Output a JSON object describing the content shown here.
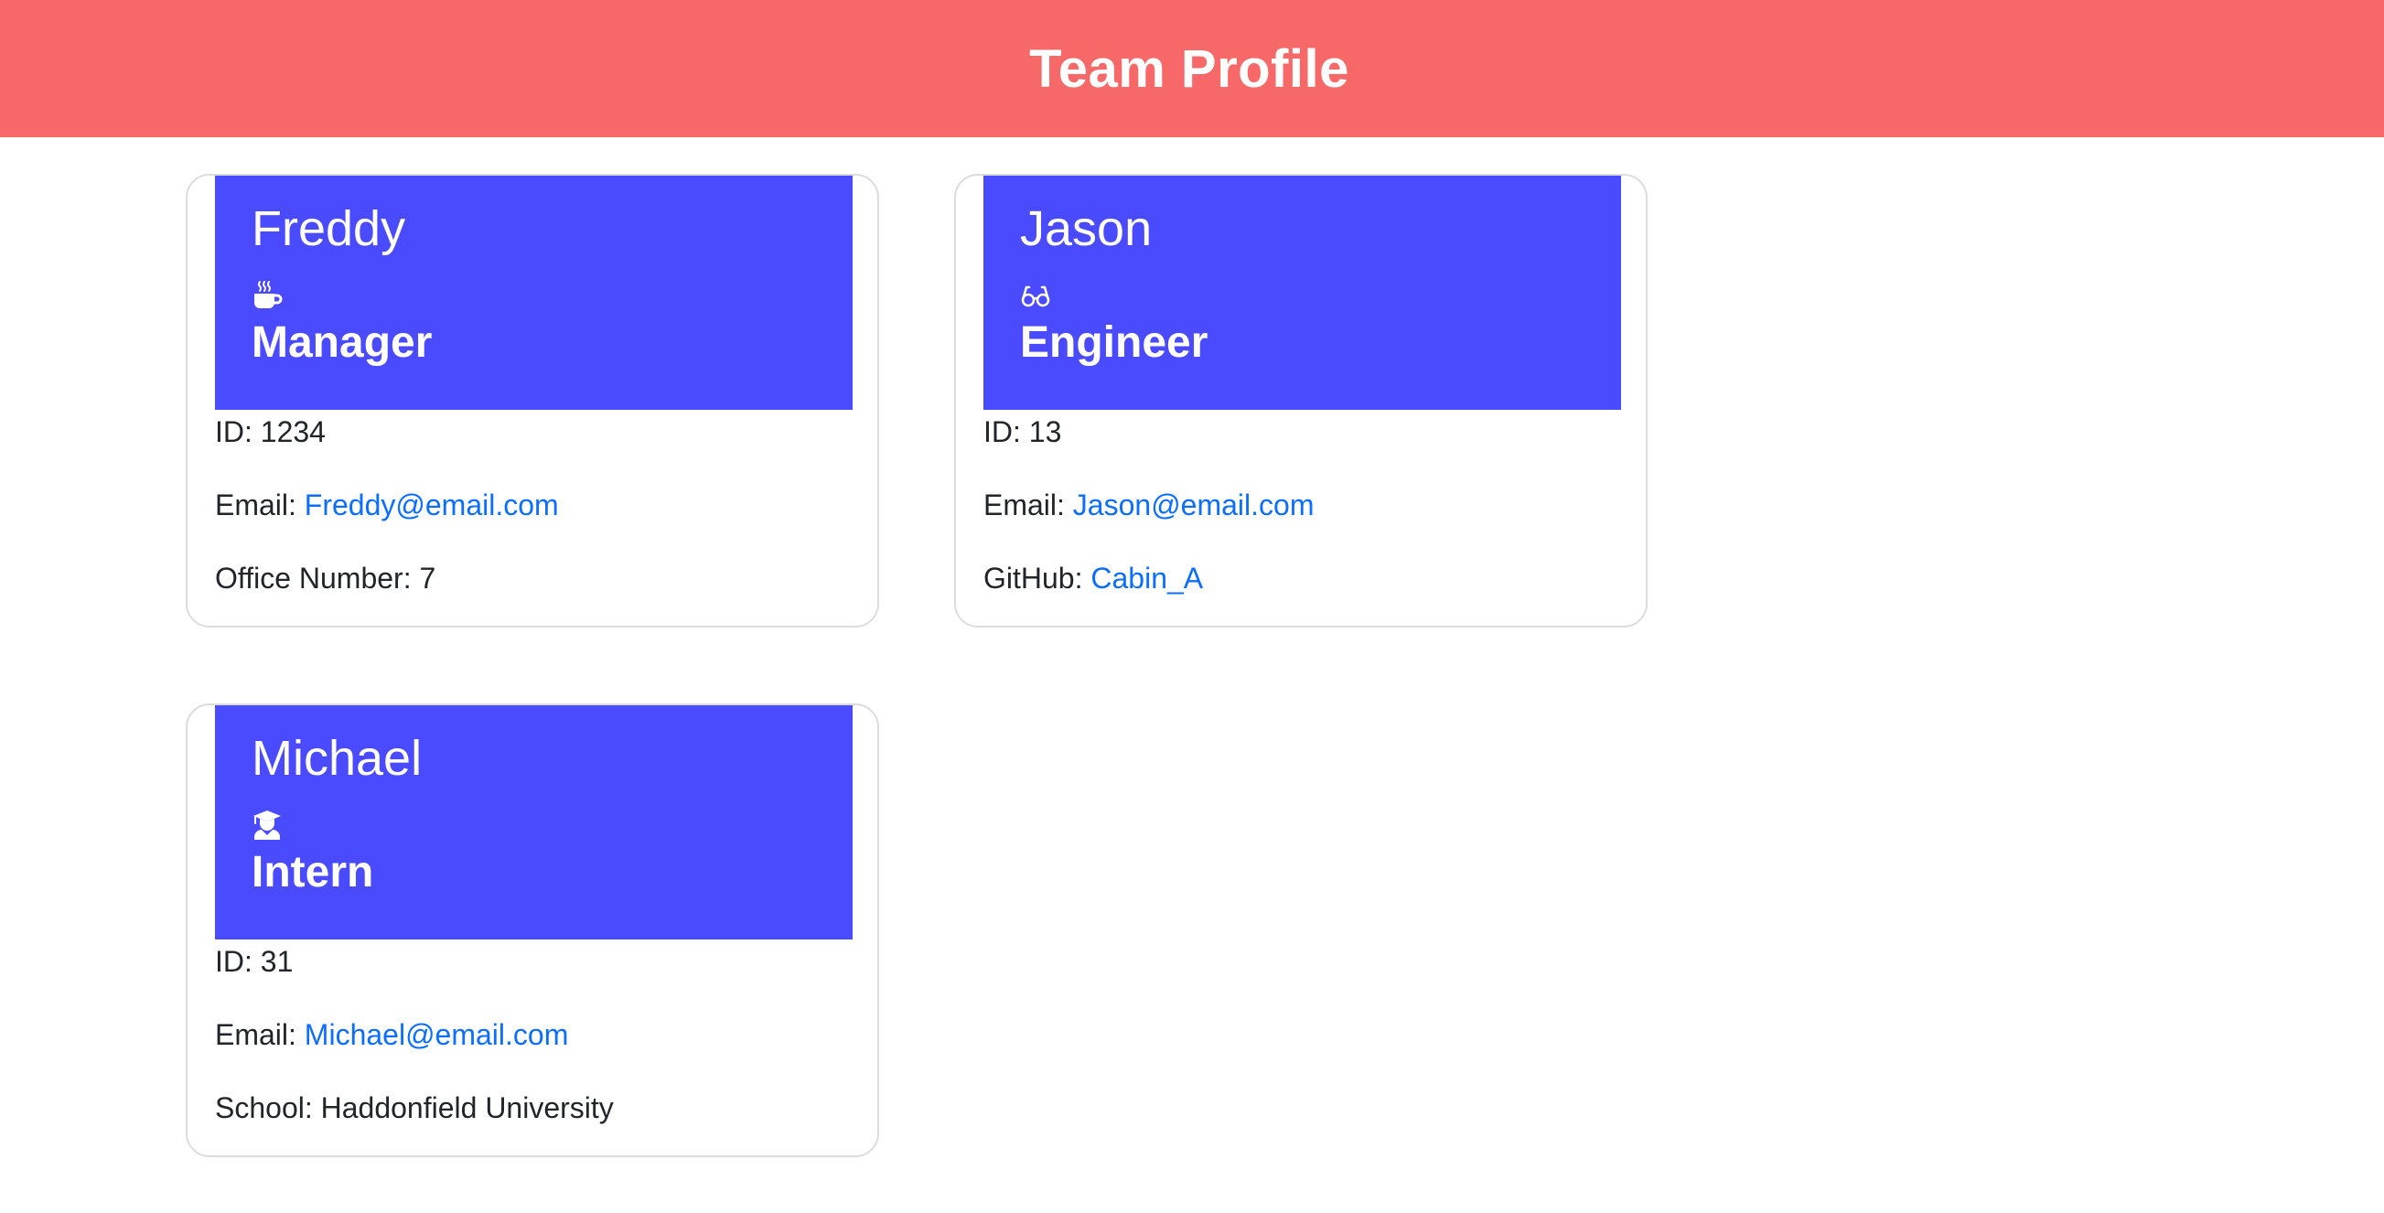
{
  "header": {
    "title": "Team Profile",
    "background_color": "#f76868"
  },
  "colors": {
    "card_header": "#4a4aff",
    "link": "#0d6efd"
  },
  "employees": [
    {
      "name": "Freddy",
      "icon": "mug-hot-icon",
      "role": "Manager",
      "id_label": "ID: ",
      "id": "1234",
      "email_label": "Email: ",
      "email": "Freddy@email.com",
      "extra_label": "Office Number: ",
      "extra_value": "7"
    },
    {
      "name": "Jason",
      "icon": "glasses-icon",
      "role": "Engineer",
      "id_label": "ID: ",
      "id": "13",
      "email_label": "Email: ",
      "email": "Jason@email.com",
      "extra_label": "GitHub: ",
      "extra_value": "Cabin_A"
    },
    {
      "name": "Michael",
      "icon": "graduate-icon",
      "role": "Intern",
      "id_label": "ID: ",
      "id": "31",
      "email_label": "Email: ",
      "email": "Michael@email.com",
      "extra_label": "School: ",
      "extra_value": "Haddonfield University"
    }
  ]
}
